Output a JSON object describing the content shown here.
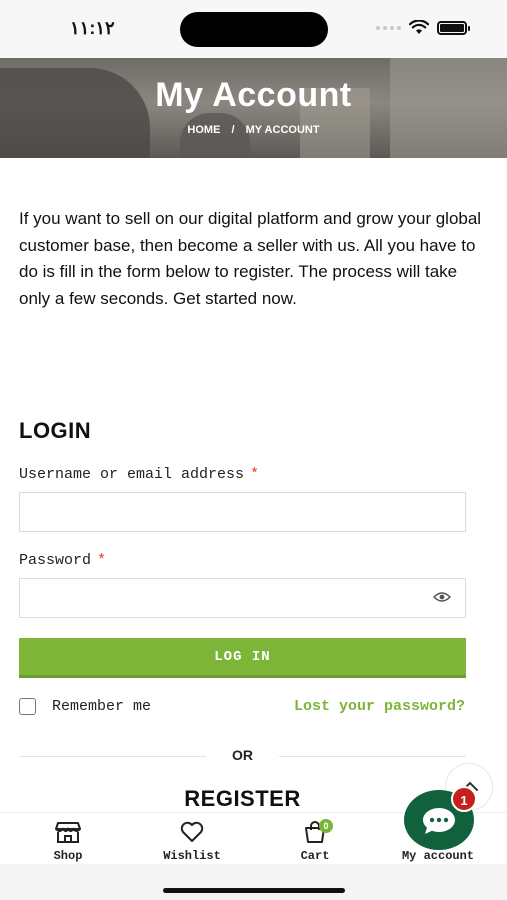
{
  "status_bar": {
    "time": "١١:١٢"
  },
  "hero": {
    "title": "My Account",
    "breadcrumb": {
      "home": "HOME",
      "separator": "/",
      "current": "MY ACCOUNT"
    }
  },
  "intro_text": "If you want to sell on our digital platform and grow your global customer base, then become a seller with us. All you have to do is fill in the form below to register. The process will take only a few seconds. Get started now.",
  "login": {
    "heading": "LOGIN",
    "username_label": "Username or email address",
    "username_value": "",
    "password_label": "Password",
    "password_value": "",
    "required_mark": "*",
    "button_label": "LOG IN",
    "remember_label": "Remember me",
    "remember_checked": false,
    "lost_password": "Lost your password?"
  },
  "divider_text": "OR",
  "register": {
    "heading": "REGISTER"
  },
  "bottom_nav": {
    "items": [
      {
        "label": "Shop",
        "icon": "store-icon"
      },
      {
        "label": "Wishlist",
        "icon": "heart-icon"
      },
      {
        "label": "Cart",
        "icon": "shopping-bag-icon",
        "badge": "0"
      },
      {
        "label": "My account",
        "icon": "user-icon"
      }
    ]
  },
  "chat": {
    "badge": "1",
    "icon": "chat-bubble-icon"
  },
  "colors": {
    "accent": "#7db539",
    "required": "#e2401c",
    "chat": "#12613d",
    "chat_badge": "#c6201e"
  }
}
